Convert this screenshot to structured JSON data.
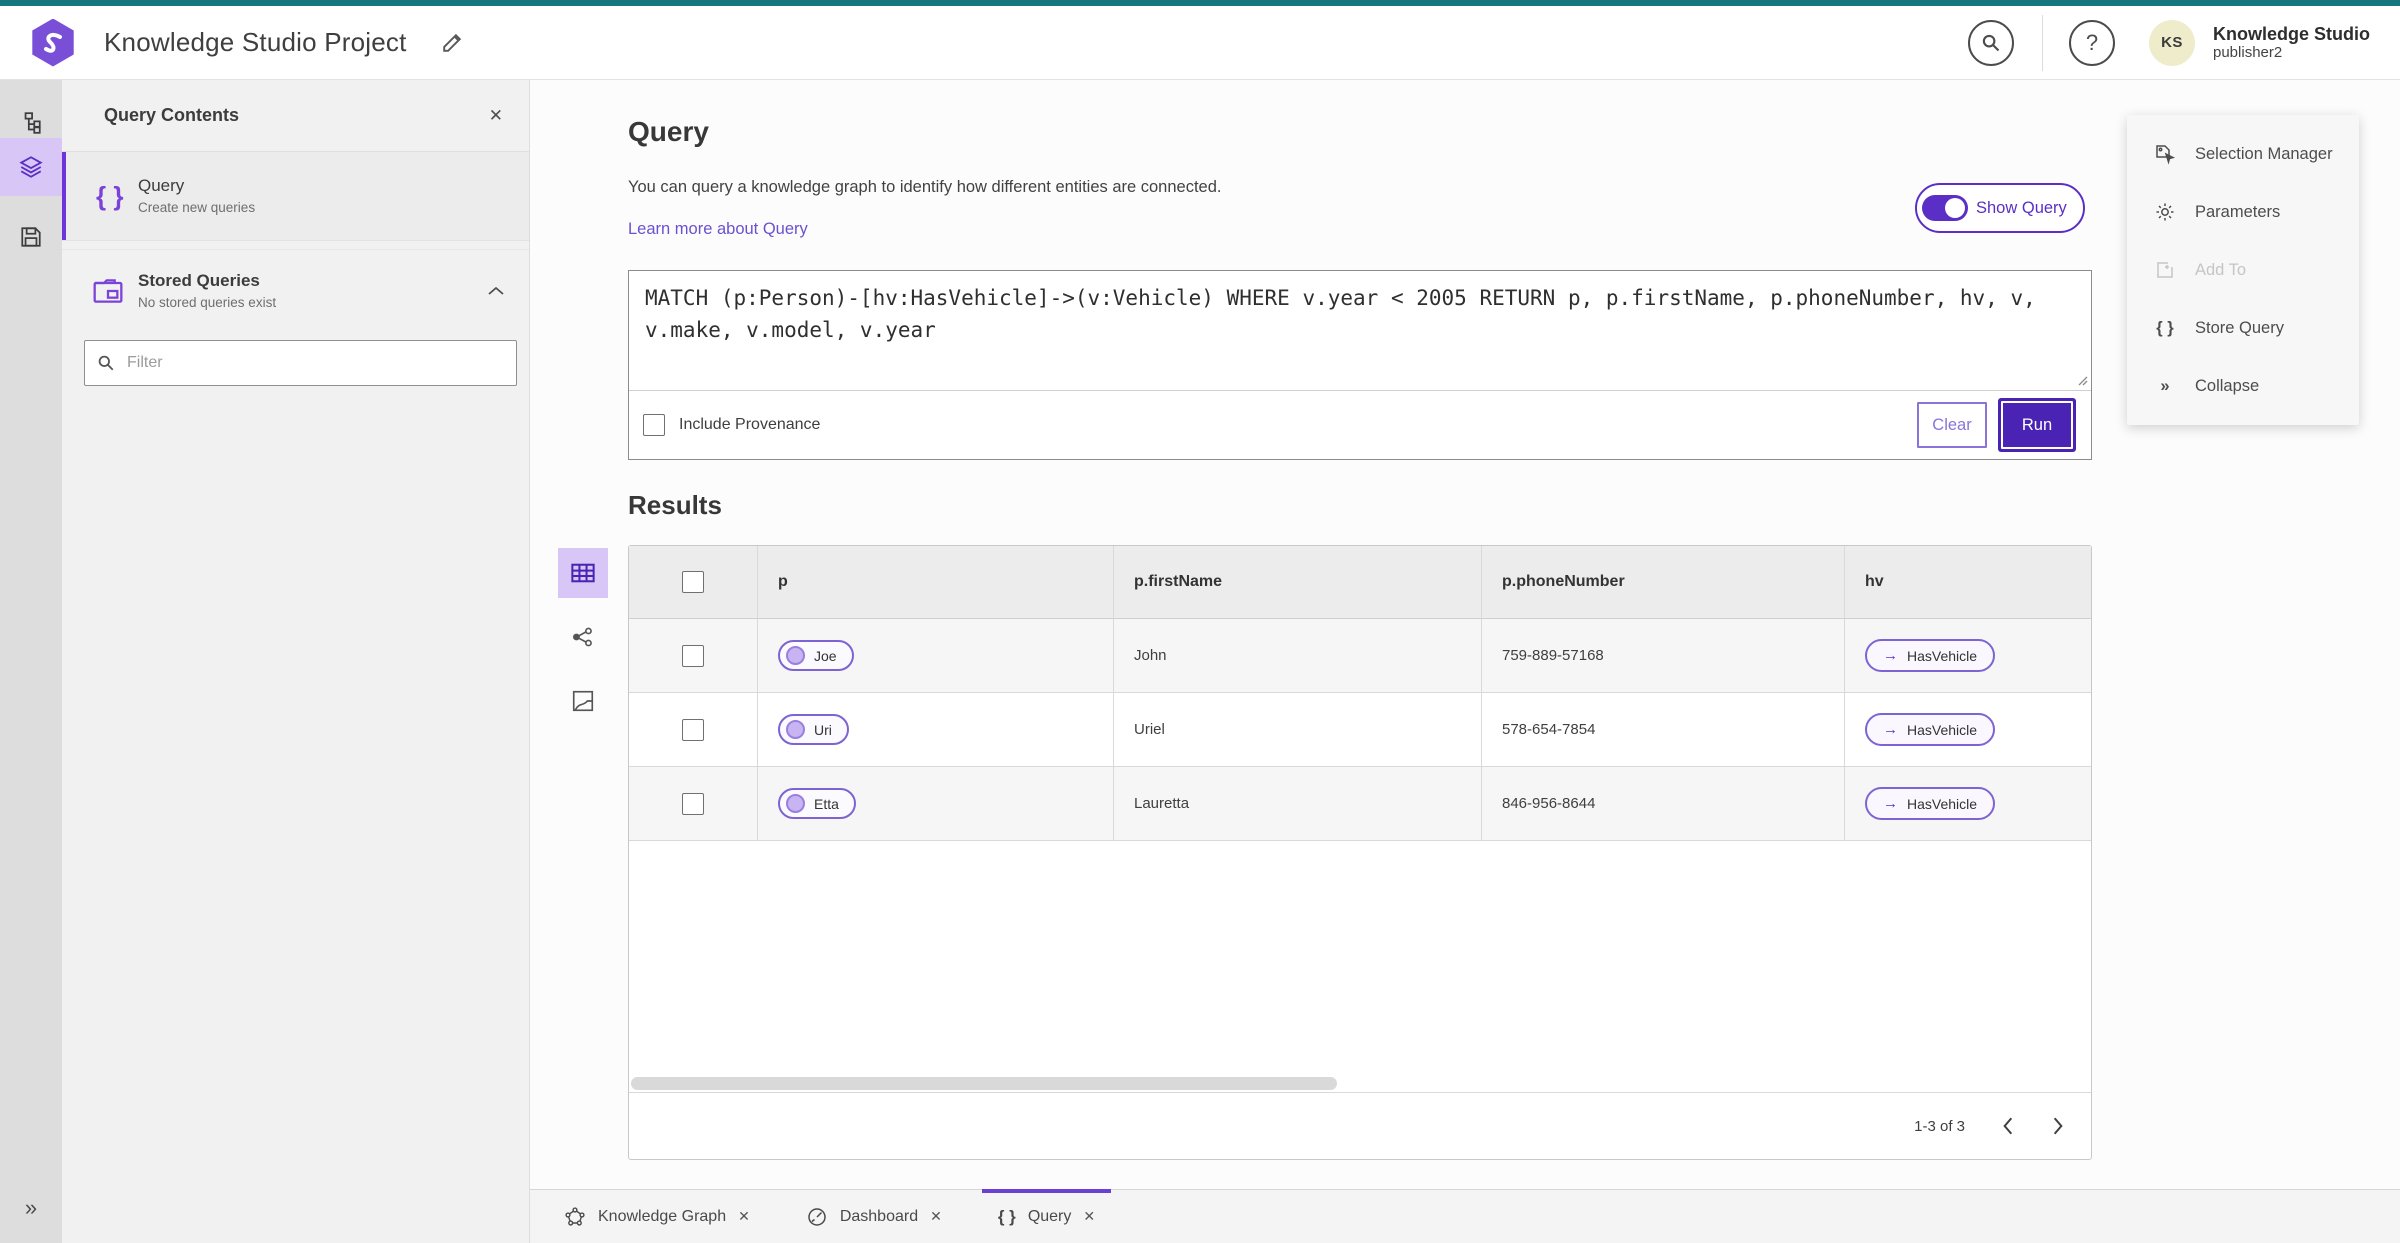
{
  "icons": {
    "close": "✕",
    "braces": "{ }",
    "arrow_right": "→",
    "collapse": "»",
    "help": "?"
  },
  "header": {
    "app_title": "Knowledge Studio Project",
    "user": {
      "initials": "KS",
      "product": "Knowledge Studio",
      "username": "publisher2"
    }
  },
  "panel": {
    "title": "Query Contents",
    "query_item": {
      "title": "Query",
      "subtitle": "Create new queries"
    },
    "stored": {
      "title": "Stored Queries",
      "subtitle": "No stored queries exist"
    },
    "filter_placeholder": "Filter"
  },
  "query_section": {
    "title": "Query",
    "description": "You can query a knowledge graph to identify how different entities are connected.",
    "link": "Learn more about Query",
    "show_query_label": "Show Query",
    "query_text": "MATCH (p:Person)-[hv:HasVehicle]->(v:Vehicle) WHERE v.year < 2005 RETURN p, p.firstName, p.phoneNumber, hv, v, v.make, v.model, v.year",
    "include_provenance_label": "Include Provenance",
    "clear_label": "Clear",
    "run_label": "Run"
  },
  "results": {
    "title": "Results",
    "columns": [
      "p",
      "p.firstName",
      "p.phoneNumber",
      "hv"
    ],
    "rows": [
      {
        "p": "Joe",
        "firstName": "John",
        "phoneNumber": "759-889-57168",
        "hv": "HasVehicle"
      },
      {
        "p": "Uri",
        "firstName": "Uriel",
        "phoneNumber": "578-654-7854",
        "hv": "HasVehicle"
      },
      {
        "p": "Etta",
        "firstName": "Lauretta",
        "phoneNumber": "846-956-8644",
        "hv": "HasVehicle"
      }
    ],
    "pagination": "1-3 of 3"
  },
  "right_menu": {
    "items": [
      {
        "label": "Selection Manager"
      },
      {
        "label": "Parameters"
      },
      {
        "label": "Add To"
      },
      {
        "label": "Store Query"
      },
      {
        "label": "Collapse"
      }
    ]
  },
  "tabs": [
    {
      "label": "Knowledge Graph"
    },
    {
      "label": "Dashboard"
    },
    {
      "label": "Query"
    }
  ],
  "colors": {
    "primary": "#4a23b4",
    "accent_light": "#d7c6f6",
    "teal": "#16767e"
  }
}
